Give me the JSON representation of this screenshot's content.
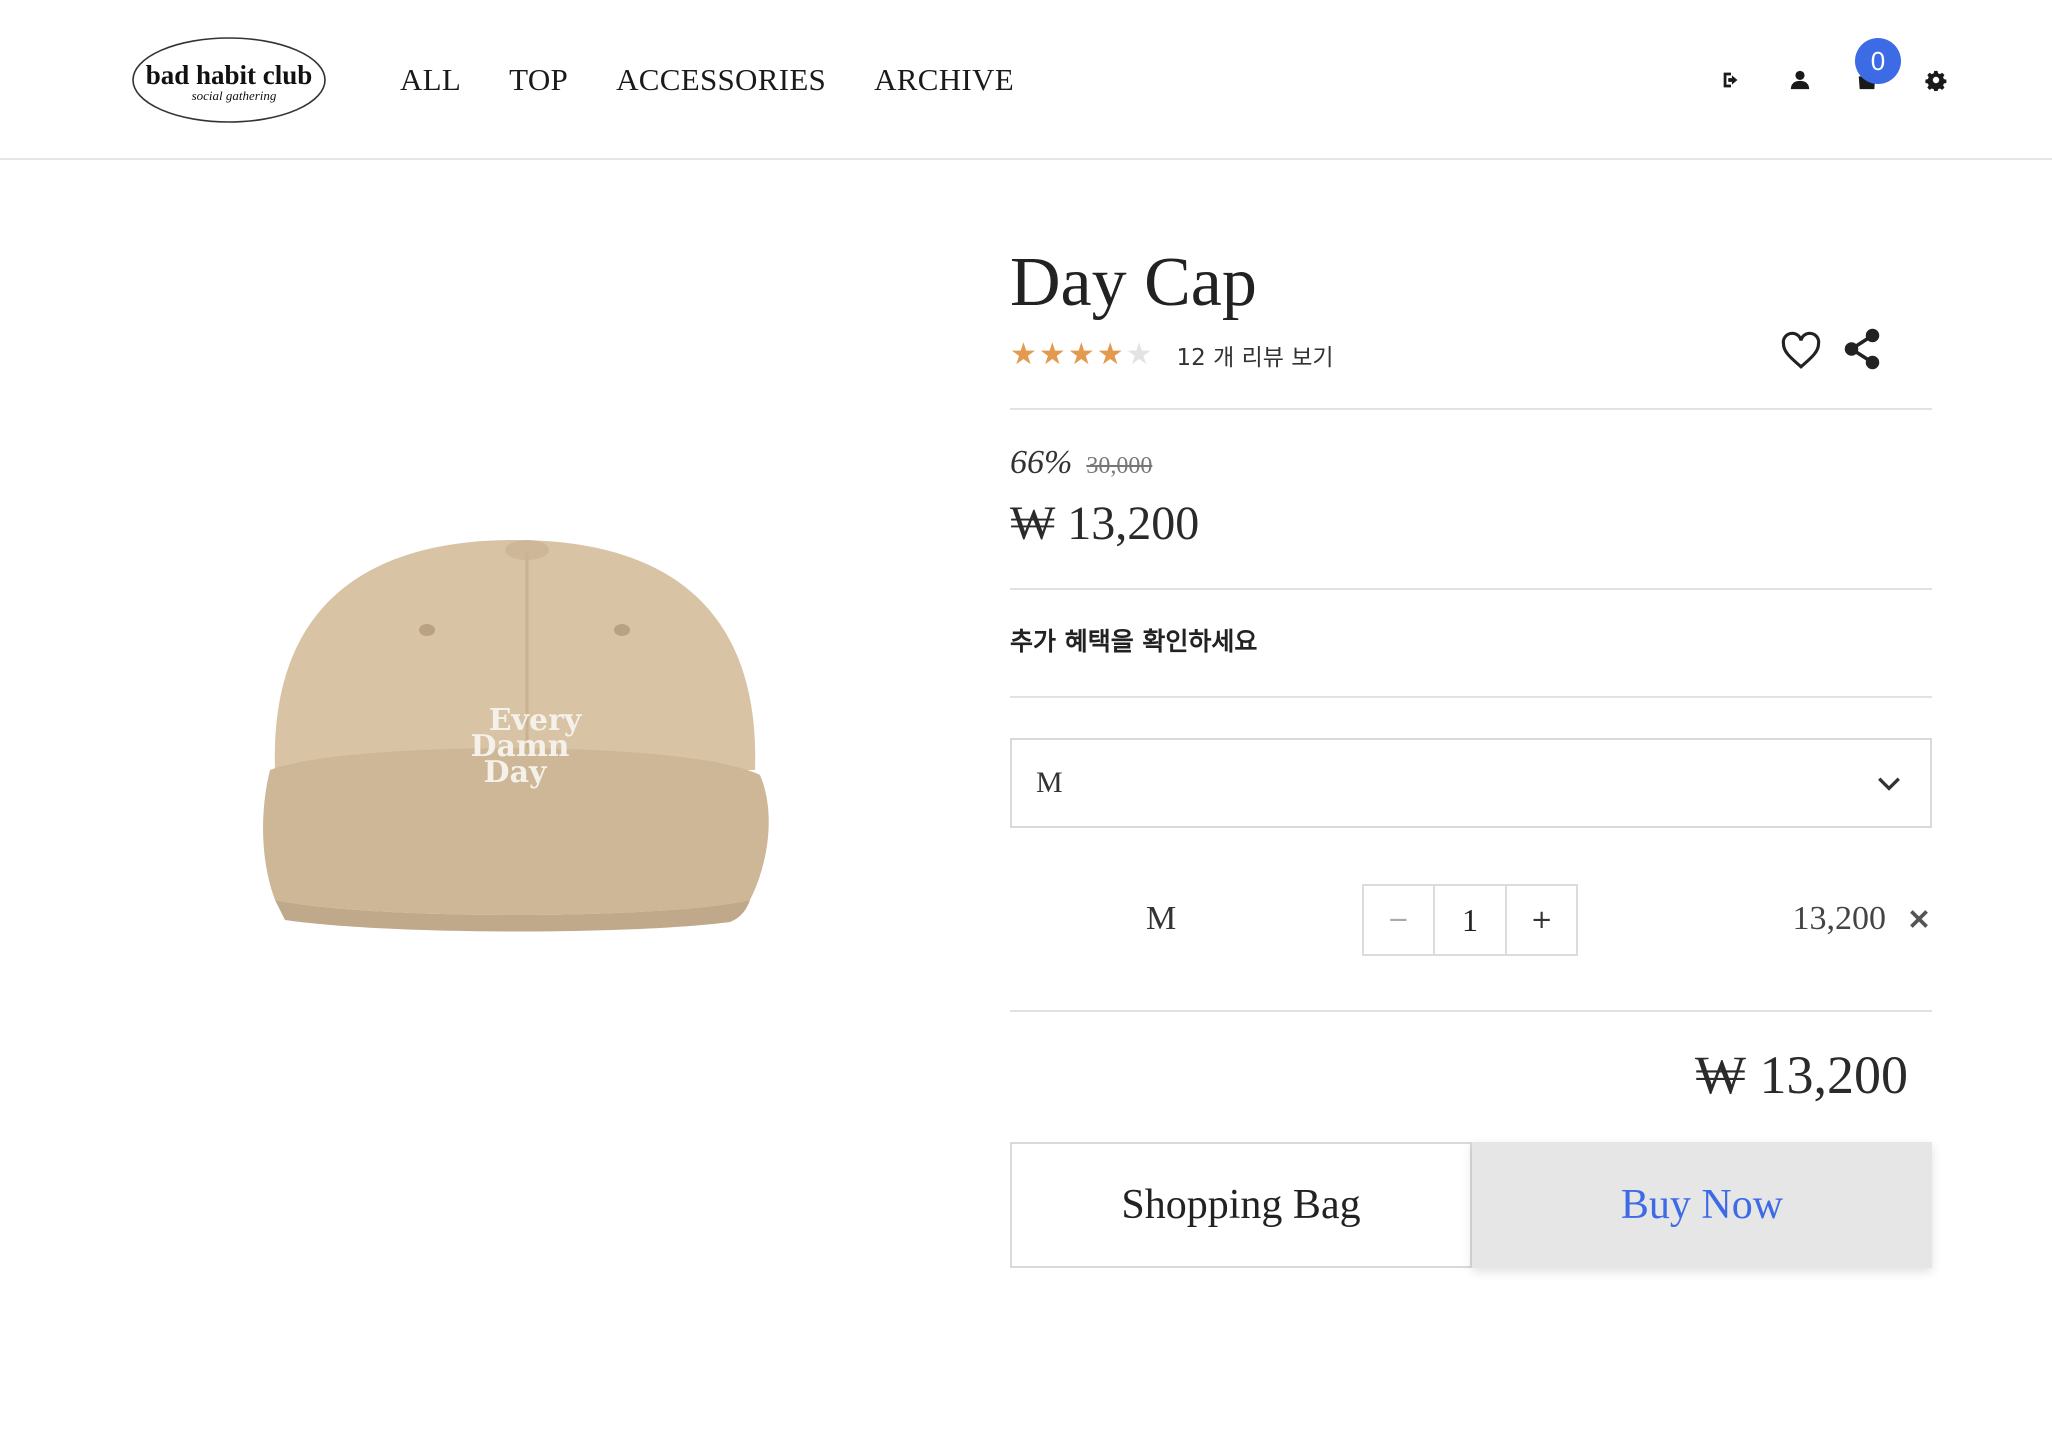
{
  "brand": {
    "name": "bad habit club",
    "tagline": "social gathering"
  },
  "nav": {
    "items": [
      {
        "label": "ALL"
      },
      {
        "label": "TOP"
      },
      {
        "label": "ACCESSORIES"
      },
      {
        "label": "ARCHIVE"
      }
    ]
  },
  "header_tools": {
    "icons": [
      "logout-icon",
      "user-icon",
      "shopping-bag-icon",
      "gear-icon"
    ],
    "cart_count": "0"
  },
  "product": {
    "title": "Day Cap",
    "rating": 4,
    "rating_max": 5,
    "reviews_label": "12 개 리뷰 보기",
    "discount": "66%",
    "original_price": "30,000",
    "price": "₩ 13,200",
    "benefit_text": "추가 혜택을 확인하세요",
    "image_text": [
      "Every",
      "Damn",
      "Day"
    ]
  },
  "option_select": {
    "selected": "M"
  },
  "selected_option": {
    "label": "M",
    "minus": "−",
    "quantity": "1",
    "plus": "+",
    "price": "13,200"
  },
  "total": "₩ 13,200",
  "actions": {
    "bag_label": "Shopping Bag",
    "buy_label": "Buy Now"
  },
  "colors": {
    "accent": "#3d6be6",
    "star": "#e39a4f",
    "cap": "#d8c3a5"
  }
}
